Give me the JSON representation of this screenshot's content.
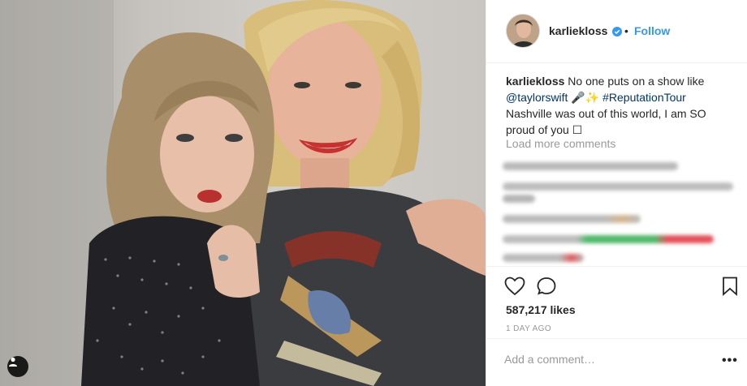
{
  "post": {
    "username": "karliekloss",
    "follow_label": "Follow",
    "separator": "•",
    "caption": {
      "username": "karliekloss",
      "line1": "No one puts on a show like",
      "mention": "@taylorswift",
      "emoji": "🎤✨",
      "hashtag": "#ReputationTour",
      "line3": "Nashville was out of this world, I am SO",
      "line4": "proud of you ☐"
    },
    "load_more_label": "Load more comments",
    "likes": "587,217 likes",
    "timestamp": "1 DAY AGO",
    "comment_placeholder": "Add a comment…",
    "more_label": "•••"
  },
  "colors": {
    "link": "#003569",
    "follow": "#3897f0",
    "muted": "#999999",
    "text": "#262626",
    "divider": "#efefef"
  },
  "icons": [
    "user-tag-icon",
    "verified-badge-icon",
    "heart-icon",
    "comment-icon",
    "bookmark-icon",
    "more-options-icon"
  ]
}
